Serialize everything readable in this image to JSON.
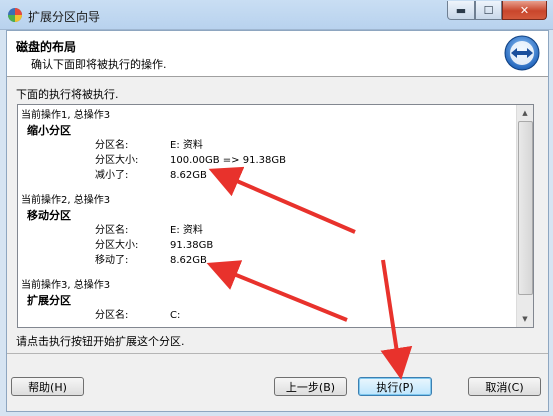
{
  "window": {
    "title": "扩展分区向导",
    "controls": {
      "minimize": "▬",
      "maximize": "☐",
      "close": "✕"
    }
  },
  "header": {
    "title": "磁盘的布局",
    "subtitle": "确认下面即将被执行的操作."
  },
  "intro": "下面的执行将被执行.",
  "operations": [
    {
      "heading": "当前操作1, 总操作3",
      "name": "缩小分区",
      "rows": [
        {
          "label": "分区名:",
          "value": "E: 资料"
        },
        {
          "label": "分区大小:",
          "value": "100.00GB => 91.38GB"
        },
        {
          "label": "减小了:",
          "value": "8.62GB"
        }
      ]
    },
    {
      "heading": "当前操作2, 总操作3",
      "name": "移动分区",
      "rows": [
        {
          "label": "分区名:",
          "value": "E: 资料"
        },
        {
          "label": "分区大小:",
          "value": "91.38GB"
        },
        {
          "label": "移动了:",
          "value": "8.62GB"
        }
      ]
    },
    {
      "heading": "当前操作3, 总操作3",
      "name": "扩展分区",
      "rows": [
        {
          "label": "分区名:",
          "value": "C:"
        }
      ]
    }
  ],
  "footer_text": "请点击执行按钮开始扩展这个分区.",
  "buttons": {
    "help": "帮助(H)",
    "back": "上一步(B)",
    "execute": "执行(P)",
    "cancel": "取消(C)"
  },
  "colors": {
    "annotation_arrow": "#e8322c"
  }
}
